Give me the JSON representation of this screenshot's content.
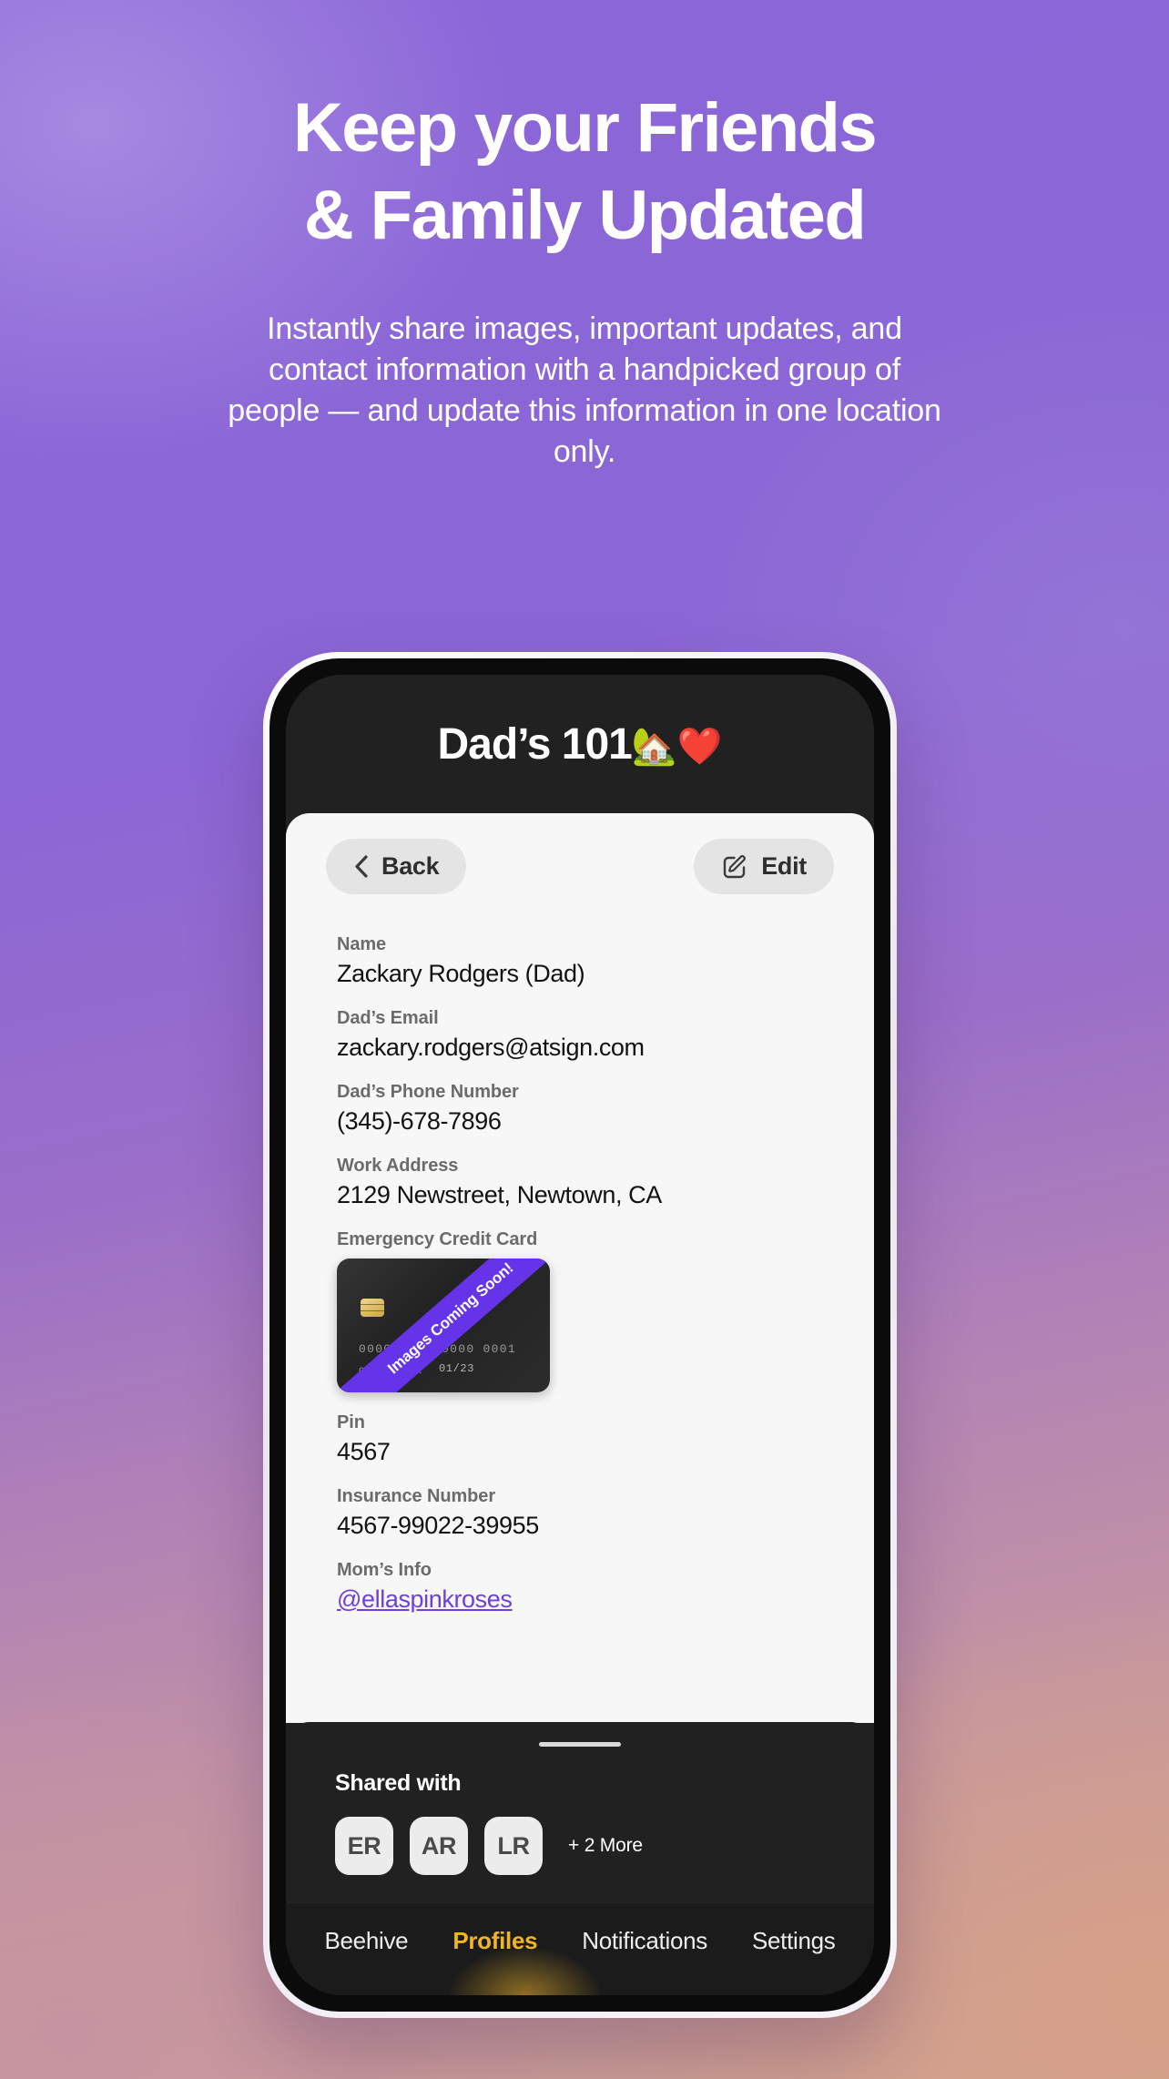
{
  "hero": {
    "heading_line1": "Keep your Friends",
    "heading_line2": "& Family Updated",
    "paragraph": "Instantly share images, important updates, and contact information with a handpicked group of people — and update this information in one location only."
  },
  "phone": {
    "app_title": "Dad’s 101",
    "app_title_emoji": "🏡❤️",
    "toolbar": {
      "back_label": "Back",
      "edit_label": "Edit"
    },
    "fields": [
      {
        "label": "Name",
        "value": "Zackary Rodgers (Dad)",
        "type": "text"
      },
      {
        "label": "Dad’s Email",
        "value": "zackary.rodgers@atsign.com",
        "type": "text"
      },
      {
        "label": "Dad’s Phone Number",
        "value": "(345)-678-7896",
        "type": "text"
      },
      {
        "label": "Work Address",
        "value": "2129 Newstreet, Newtown, CA",
        "type": "text"
      },
      {
        "label": "Emergency Credit Card",
        "value": "",
        "type": "image"
      },
      {
        "label": "Pin",
        "value": "4567",
        "type": "text"
      },
      {
        "label": "Insurance Number",
        "value": "4567-99022-39955",
        "type": "text"
      },
      {
        "label": "Mom’s Info",
        "value": "@ellaspinkroses",
        "type": "link"
      }
    ],
    "credit_card": {
      "number": "0000  0000  0000  0001",
      "holder": "CARDHOLDER",
      "expiry": "01/23",
      "ribbon_text": "Images Coming Soon!"
    },
    "shared": {
      "title": "Shared with",
      "avatars": [
        "ER",
        "AR",
        "LR"
      ],
      "more_label": "+ 2 More"
    },
    "tabs": [
      {
        "label": "Beehive",
        "active": false
      },
      {
        "label": "Profiles",
        "active": true
      },
      {
        "label": "Notifications",
        "active": false
      },
      {
        "label": "Settings",
        "active": false
      }
    ]
  },
  "colors": {
    "accent_purple": "#6634e8",
    "link_purple": "#6d3fe0",
    "active_tab": "#f0b429",
    "dark_panel": "#212121",
    "sheet": "#f7f7f7"
  }
}
